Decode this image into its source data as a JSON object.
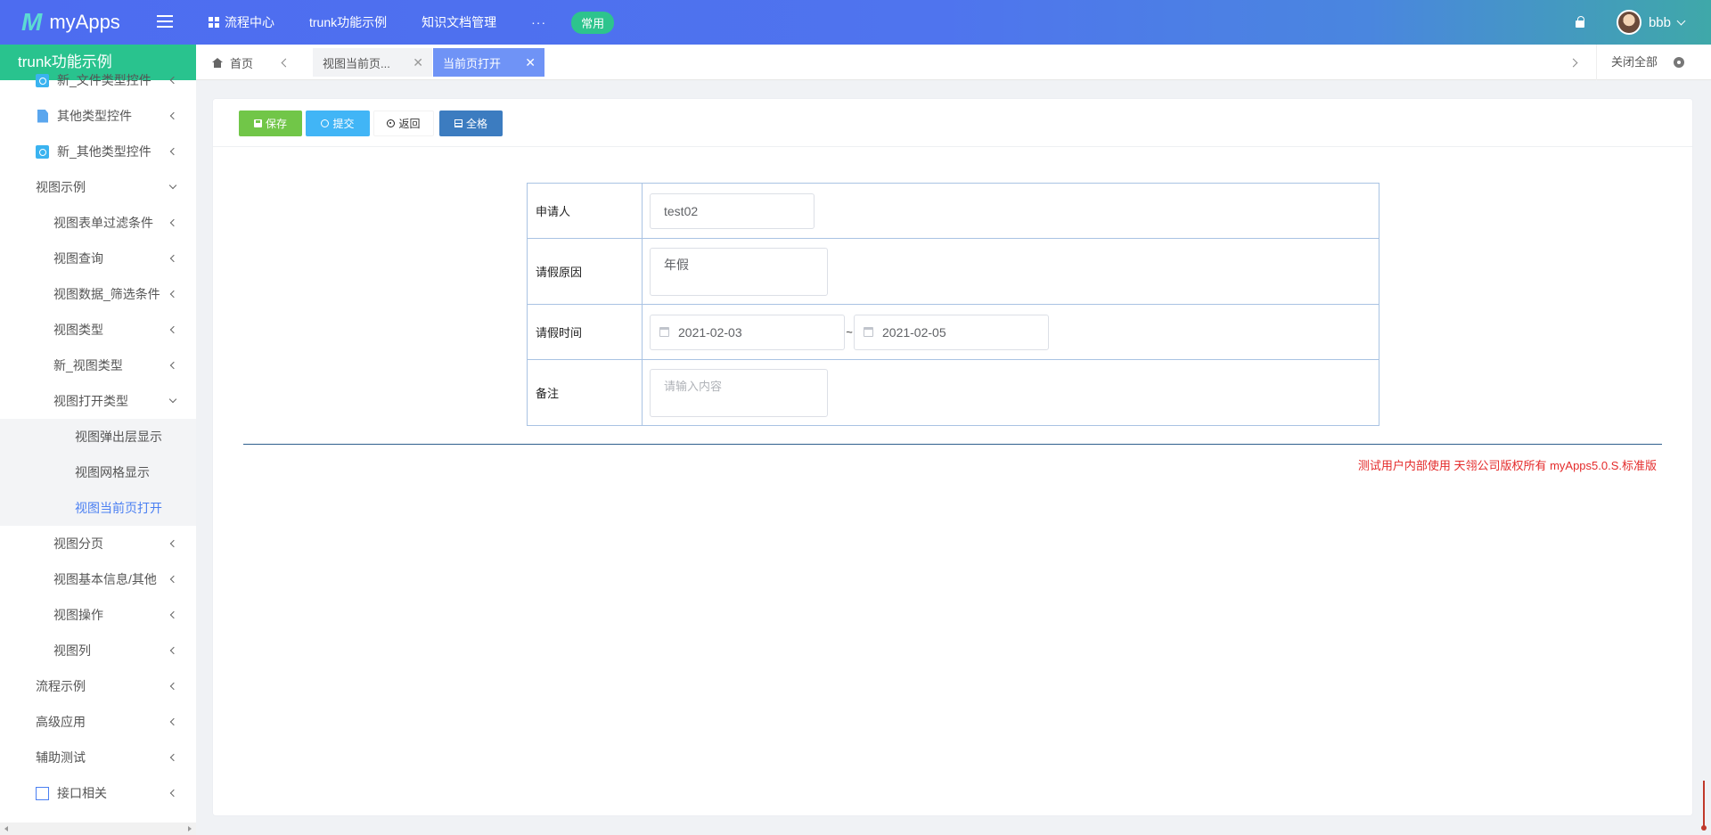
{
  "app": {
    "logo_mark": "M",
    "name": "myApps"
  },
  "topnav": {
    "items": [
      "流程中心",
      "trunk功能示例",
      "知识文档管理"
    ],
    "more": "···",
    "badge": "常用"
  },
  "user": {
    "name": "bbb"
  },
  "sidebar": {
    "title": "trunk功能示例",
    "items": [
      {
        "label": "新_文件类型控件",
        "icon": "target-icon"
      },
      {
        "label": "其他类型控件",
        "icon": "document-icon"
      },
      {
        "label": "新_其他类型控件",
        "icon": "target-icon"
      },
      {
        "label": "视图示例",
        "expanded": true
      },
      {
        "label": "视图表单过滤条件"
      },
      {
        "label": "视图查询"
      },
      {
        "label": "视图数据_筛选条件"
      },
      {
        "label": "视图类型"
      },
      {
        "label": "新_视图类型"
      },
      {
        "label": "视图打开类型",
        "expanded": true
      },
      {
        "label": "视图弹出层显示"
      },
      {
        "label": "视图网格显示"
      },
      {
        "label": "视图当前页打开",
        "active": true
      },
      {
        "label": "视图分页"
      },
      {
        "label": "视图基本信息/其他"
      },
      {
        "label": "视图操作"
      },
      {
        "label": "视图列"
      },
      {
        "label": "流程示例"
      },
      {
        "label": "高级应用"
      },
      {
        "label": "辅助测试"
      },
      {
        "label": "接口相关",
        "icon": "frame-icon"
      }
    ]
  },
  "tabs": {
    "home": "首页",
    "items": [
      {
        "label": "视图当前页...",
        "active": false
      },
      {
        "label": "当前页打开",
        "active": true
      }
    ],
    "close_all": "关闭全部",
    "close_glyph": "✕"
  },
  "toolbar": {
    "save": "保存",
    "submit": "提交",
    "back": "返回",
    "fullgrid": "全格"
  },
  "form": {
    "applicant_label": "申请人",
    "applicant_value": "test02",
    "reason_label": "请假原因",
    "reason_value": "年假",
    "time_label": "请假时间",
    "date_start": "2021-02-03",
    "date_sep": "~",
    "date_end": "2021-02-05",
    "remark_label": "备注",
    "remark_placeholder": "请输入内容"
  },
  "footer": {
    "copyright": "测试用户内部使用 天翎公司版权所有 myApps5.0.S.标准版"
  },
  "colors": {
    "topbar_start": "#4d6cf0",
    "sidebar_header": "#29c38e",
    "active_tab": "#6f93f6",
    "save_btn": "#71c648",
    "submit_btn": "#41b5f6",
    "fullgrid_btn": "#3c7cc0",
    "copyright": "#e42b2b",
    "active_link": "#4a7ff2"
  }
}
